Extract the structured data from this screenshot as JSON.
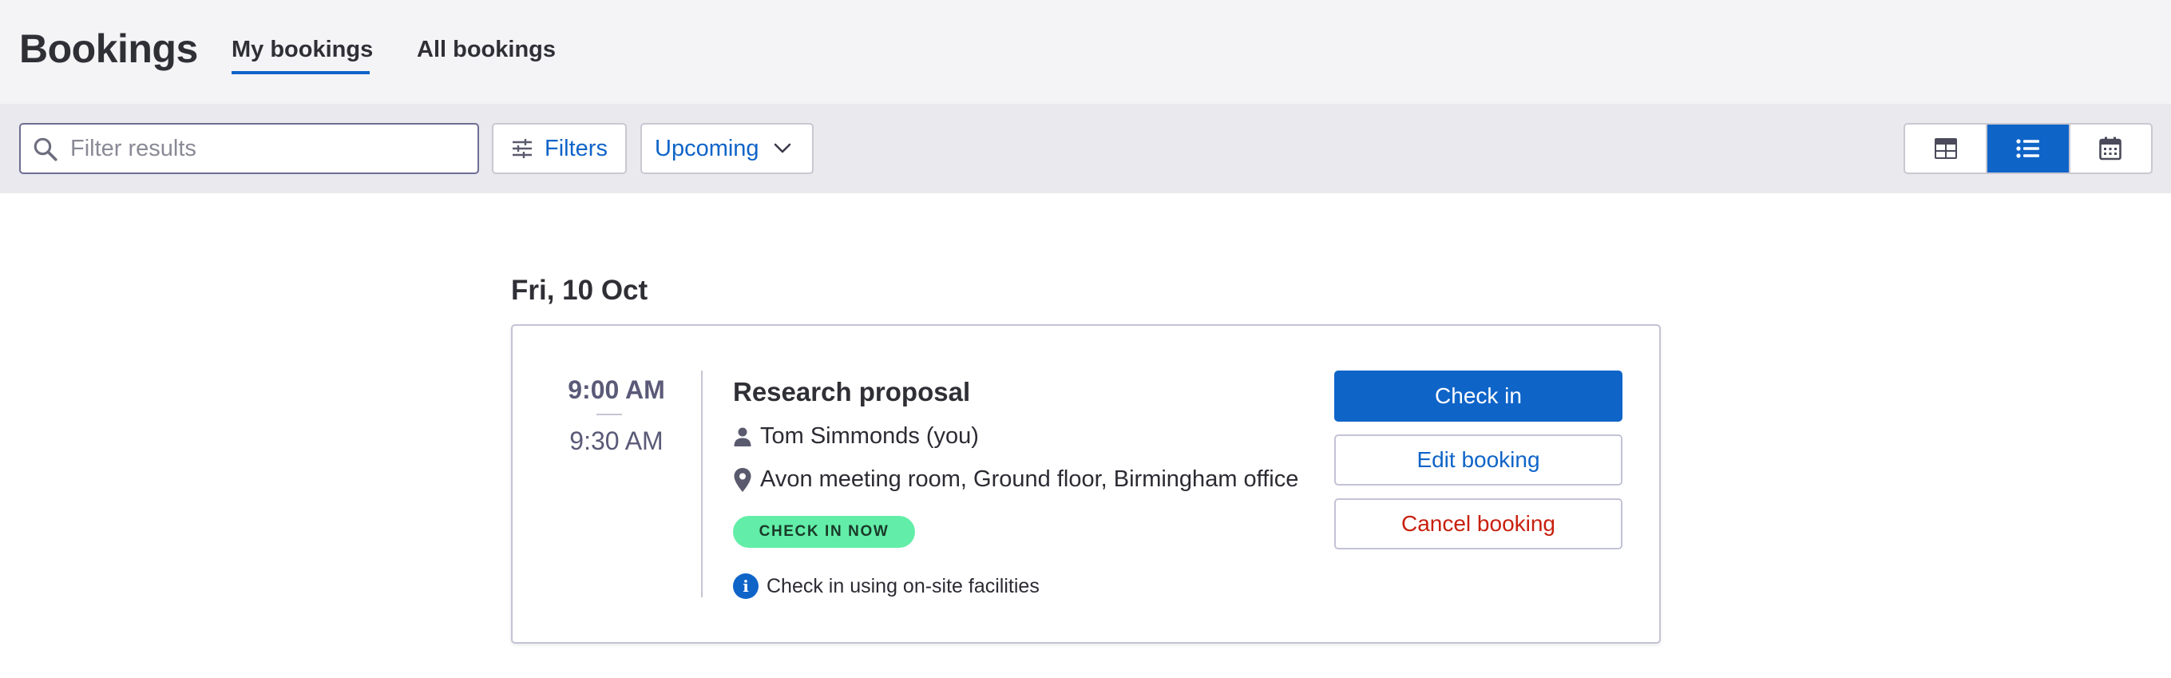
{
  "header": {
    "title": "Bookings",
    "tabs": [
      {
        "label": "My bookings",
        "active": true
      },
      {
        "label": "All bookings",
        "active": false
      }
    ]
  },
  "toolbar": {
    "search": {
      "placeholder": "Filter results",
      "value": ""
    },
    "filters_label": "Filters",
    "period_select": {
      "selected": "Upcoming"
    },
    "views": [
      {
        "icon": "table-view-icon",
        "active": false
      },
      {
        "icon": "list-view-icon",
        "active": true
      },
      {
        "icon": "calendar-view-icon",
        "active": false
      }
    ]
  },
  "booking_group": {
    "date": "Fri, 10 Oct",
    "booking": {
      "start_time": "9:00 AM",
      "end_time": "9:30 AM",
      "title": "Research proposal",
      "person": "Tom Simmonds (you)",
      "location": "Avon meeting room, Ground floor, Birmingham office",
      "status_badge": "CHECK IN NOW",
      "info_note": "Check in using on-site facilities",
      "actions": {
        "check_in": "Check in",
        "edit": "Edit booking",
        "cancel": "Cancel booking"
      }
    }
  },
  "colors": {
    "accent": "#0f64c8",
    "danger": "#c8200e",
    "badge": "#62eea8",
    "header_bg": "#f4f4f7",
    "toolbar_bg": "#e9e9ee"
  }
}
